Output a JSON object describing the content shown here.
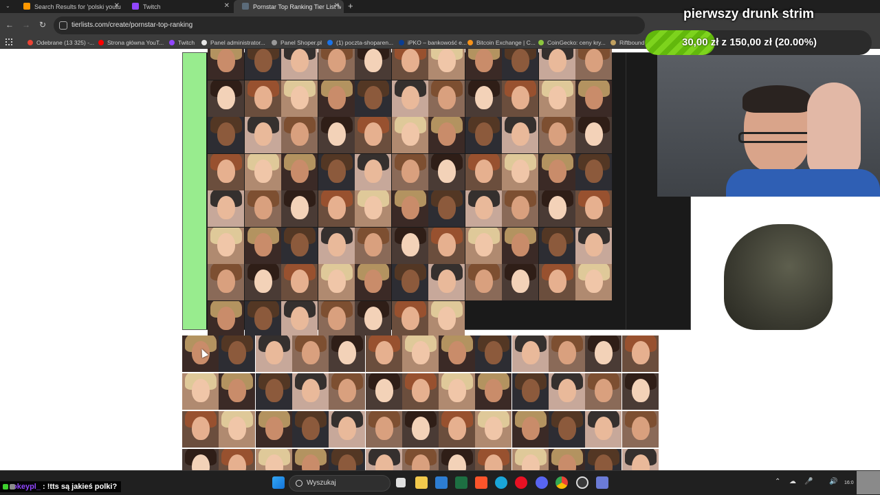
{
  "browser": {
    "tabs": [
      {
        "title": "Search Results for 'polski youtu",
        "favicon_color": "#ff9800",
        "active": false
      },
      {
        "title": "Twitch",
        "favicon_color": "#9146ff",
        "active": false
      },
      {
        "title": "Pornstar Top Ranking Tier List M",
        "favicon_color": "#5b6b7a",
        "active": true
      }
    ],
    "new_tab_label": "+",
    "url": "tierlists.com/create/pornstar-top-ranking",
    "bookmarks": [
      {
        "label": "Odebrane (13 325) -...",
        "color": "#ea4335"
      },
      {
        "label": "Strona główna YouT...",
        "color": "#ff0000"
      },
      {
        "label": "Twitch",
        "color": "#9146ff"
      },
      {
        "label": "Panel administrator...",
        "color": "#e8e8e8"
      },
      {
        "label": "Panel Shoper.pl",
        "color": "#999999"
      },
      {
        "label": "(1) poczta-shoparen...",
        "color": "#1a73e8"
      },
      {
        "label": "iPKO – bankowość e...",
        "color": "#0b3d91"
      },
      {
        "label": "Bitcoin Exchange | C...",
        "color": "#f7931a"
      },
      {
        "label": "CoinGecko: ceny kry...",
        "color": "#8dc63f"
      },
      {
        "label": "Riftbound",
        "color": "#c0a060"
      }
    ]
  },
  "overlay": {
    "stream_title": "pierwszy drunk strim",
    "goal_text": "30,00 zł z 150,00 zł (20.00%)",
    "goal_progress": 0.2
  },
  "taskbar": {
    "search_label": "Wyszukaj",
    "clock": "16:0"
  },
  "chat": {
    "user": "okeypl_",
    "message": ": !tts są jakieś polki?"
  },
  "tier_list": {
    "tier_color": "#98ec8e",
    "ranked_tile_count": 84,
    "pool_tile_count": 52
  }
}
